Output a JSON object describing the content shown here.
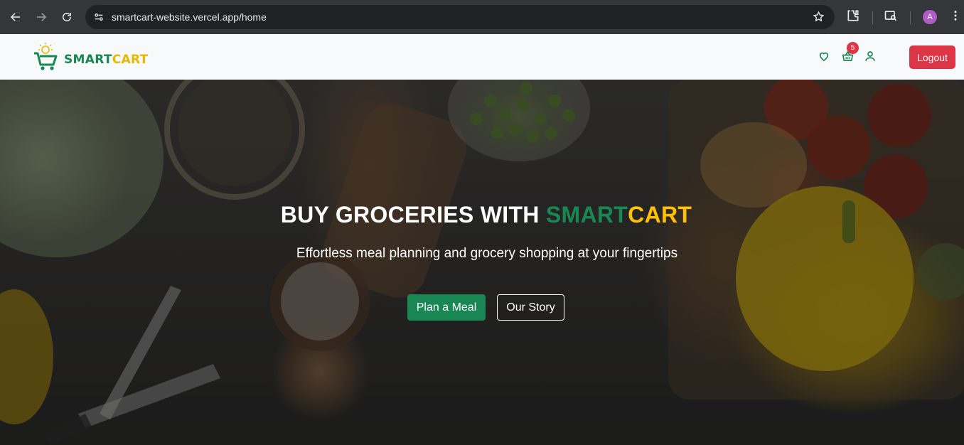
{
  "browser": {
    "url": "smartcart-website.vercel.app/home",
    "profile_initial": "A",
    "icons": [
      "back-arrow-icon",
      "forward-arrow-icon",
      "reload-icon",
      "site-info-icon",
      "bookmark-star-icon",
      "extensions-icon",
      "tab-search-icon",
      "more-menu-icon"
    ]
  },
  "header": {
    "logo": {
      "smart": "SMART",
      "cart": "CART"
    },
    "cart_count": "5",
    "logout_label": "Logout",
    "icons": [
      "heart-icon",
      "basket-icon",
      "user-icon"
    ]
  },
  "hero": {
    "title_prefix": "BUY GROCERIES WITH ",
    "title_smart": "SMART",
    "title_cart": "CART",
    "subtitle": "Effortless meal planning and grocery shopping at your fingertips",
    "primary_button": "Plan a Meal",
    "secondary_button": "Our Story"
  },
  "colors": {
    "brand_green": "#198754",
    "brand_yellow": "#ffc107",
    "logout_red": "#dc3545"
  }
}
